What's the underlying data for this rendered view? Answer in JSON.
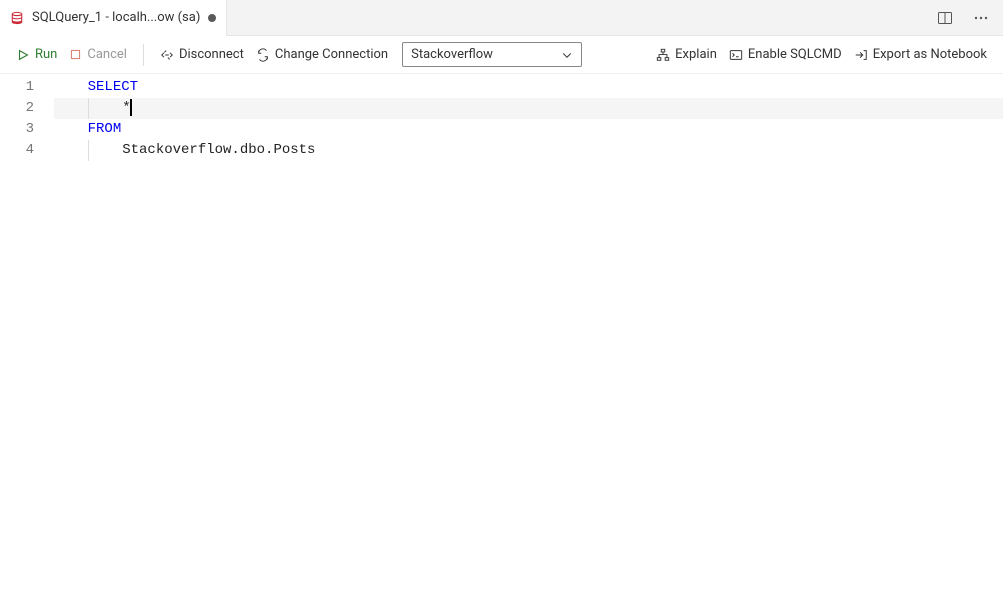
{
  "tab": {
    "title": "SQLQuery_1 - localh...ow (sa)",
    "dirty": true
  },
  "toolbar": {
    "run": "Run",
    "cancel": "Cancel",
    "disconnect": "Disconnect",
    "change_connection": "Change Connection",
    "database": "Stackoverflow",
    "explain": "Explain",
    "enable_sqlcmd": "Enable SQLCMD",
    "export_notebook": "Export as Notebook"
  },
  "editor": {
    "lines": [
      {
        "num": "1",
        "tokens": [
          {
            "t": "SELECT",
            "c": "keyword"
          }
        ],
        "indent": 1
      },
      {
        "num": "2",
        "tokens": [
          {
            "t": "*",
            "c": "identifier"
          }
        ],
        "indent": 2,
        "current": true,
        "cursor": true
      },
      {
        "num": "3",
        "tokens": [
          {
            "t": "FROM",
            "c": "keyword"
          }
        ],
        "indent": 1
      },
      {
        "num": "4",
        "tokens": [
          {
            "t": "Stackoverflow.dbo.Posts",
            "c": "identifier"
          }
        ],
        "indent": 2
      }
    ]
  }
}
